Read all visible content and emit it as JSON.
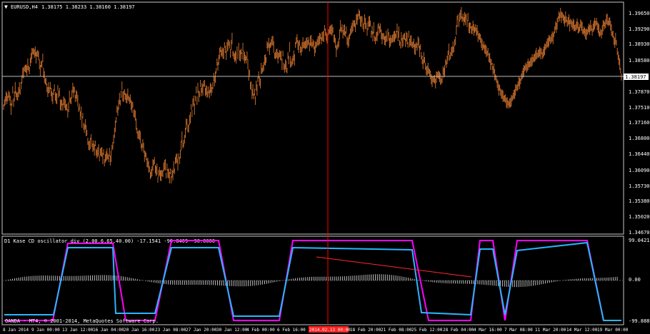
{
  "main_chart": {
    "symbol_timeframe": "EURUSD,H4",
    "ohlc_readout": "1.38175 1.38233 1.38160 1.38197",
    "current_price": "1.38197",
    "price_ticks": [
      "1.39650",
      "1.39290",
      "1.38930",
      "1.38580",
      "1.37870",
      "1.37510",
      "1.37160",
      "1.36800",
      "1.36440",
      "1.36090",
      "1.35730",
      "1.35380",
      "1.35020",
      "1.34670"
    ],
    "series_shape": [
      0.56,
      0.58,
      0.59,
      0.61,
      0.6,
      0.6,
      0.62,
      0.61,
      0.59,
      0.55,
      0.58,
      0.64,
      0.58,
      0.61,
      0.65,
      0.62,
      0.61,
      0.61,
      0.63,
      0.65,
      0.63,
      0.66,
      0.69,
      0.72,
      0.72,
      0.74,
      0.74,
      0.74,
      0.73,
      0.76,
      0.74,
      0.73,
      0.77,
      0.79,
      0.81,
      0.82,
      0.82,
      0.81,
      0.82,
      0.79,
      0.81,
      0.81,
      0.8,
      0.76,
      0.73,
      0.76,
      0.76,
      0.79,
      0.72,
      0.7,
      0.68,
      0.68,
      0.65,
      0.63,
      0.65,
      0.64,
      0.66,
      0.63,
      0.61,
      0.6,
      0.63,
      0.65,
      0.61,
      0.6,
      0.6,
      0.65,
      0.62,
      0.63,
      0.57,
      0.57,
      0.58,
      0.56,
      0.59,
      0.58,
      0.57,
      0.56,
      0.56,
      0.53,
      0.56,
      0.61,
      0.59,
      0.59,
      0.62,
      0.65,
      0.63,
      0.64,
      0.6,
      0.62,
      0.61,
      0.59,
      0.55,
      0.56,
      0.52,
      0.54,
      0.49,
      0.52,
      0.47,
      0.46,
      0.48,
      0.45,
      0.44,
      0.4,
      0.38,
      0.38,
      0.39,
      0.42,
      0.39,
      0.37,
      0.38,
      0.36,
      0.39,
      0.35,
      0.34,
      0.35,
      0.36,
      0.32,
      0.35,
      0.35,
      0.35,
      0.32,
      0.35,
      0.3,
      0.32,
      0.33,
      0.34,
      0.33,
      0.32,
      0.35,
      0.31,
      0.33,
      0.37,
      0.38,
      0.41,
      0.44,
      0.47,
      0.5,
      0.55,
      0.54,
      0.57,
      0.6,
      0.58,
      0.62,
      0.66,
      0.61,
      0.61,
      0.63,
      0.61,
      0.6,
      0.6,
      0.62,
      0.6,
      0.59,
      0.6,
      0.57,
      0.56,
      0.57,
      0.53,
      0.53,
      0.52,
      0.48,
      0.45,
      0.43,
      0.43,
      0.43,
      0.42,
      0.38,
      0.37,
      0.39,
      0.37,
      0.33,
      0.34,
      0.33,
      0.3,
      0.3,
      0.28,
      0.27,
      0.24,
      0.25,
      0.26,
      0.29,
      0.3,
      0.31,
      0.27,
      0.26,
      0.27,
      0.22,
      0.25,
      0.26,
      0.24,
      0.24,
      0.25,
      0.25,
      0.28,
      0.29,
      0.29,
      0.24,
      0.28,
      0.25,
      0.25,
      0.23,
      0.26,
      0.22,
      0.25,
      0.24,
      0.28,
      0.26,
      0.31,
      0.32,
      0.32,
      0.29,
      0.33,
      0.31,
      0.34,
      0.38,
      0.42,
      0.38,
      0.39,
      0.41,
      0.44,
      0.48,
      0.49,
      0.46,
      0.46,
      0.5,
      0.51,
      0.56,
      0.53,
      0.58,
      0.59,
      0.55,
      0.6,
      0.64,
      0.59,
      0.65,
      0.61,
      0.62,
      0.67,
      0.63,
      0.65,
      0.64,
      0.67,
      0.67,
      0.63,
      0.64,
      0.63,
      0.62,
      0.64,
      0.62,
      0.65,
      0.64,
      0.64,
      0.66,
      0.7,
      0.68,
      0.7,
      0.73,
      0.77,
      0.75,
      0.78,
      0.81,
      0.83,
      0.81,
      0.82,
      0.81,
      0.81,
      0.85,
      0.83,
      0.8,
      0.84,
      0.85,
      0.86,
      0.85,
      0.81,
      0.85,
      0.88,
      0.81,
      0.8,
      0.79,
      0.8,
      0.79,
      0.83,
      0.8,
      0.84,
      0.8,
      0.8,
      0.82,
      0.8,
      0.84,
      0.8,
      0.79,
      0.79,
      0.78,
      0.8,
      0.76,
      0.71,
      0.72,
      0.66,
      0.66,
      0.62,
      0.64,
      0.61,
      0.63,
      0.59,
      0.66,
      0.64,
      0.69,
      0.71,
      0.68,
      0.67,
      0.74,
      0.73,
      0.74,
      0.75,
      0.78,
      0.78,
      0.78,
      0.85,
      0.84,
      0.86,
      0.83,
      0.85,
      0.86,
      0.87,
      0.87,
      0.84,
      0.8,
      0.8,
      0.81,
      0.81,
      0.79,
      0.8,
      0.81,
      0.8,
      0.8,
      0.76,
      0.81,
      0.75,
      0.74,
      0.76,
      0.75,
      0.73,
      0.8,
      0.78,
      0.84,
      0.77,
      0.76,
      0.77,
      0.78,
      0.8,
      0.78,
      0.85,
      0.87,
      0.88,
      0.85,
      0.84,
      0.86,
      0.83,
      0.82,
      0.84,
      0.86,
      0.85,
      0.85,
      0.85,
      0.86,
      0.86,
      0.86,
      0.87,
      0.84,
      0.87,
      0.87,
      0.85,
      0.86,
      0.85,
      0.82,
      0.84,
      0.85,
      0.86,
      0.87,
      0.87,
      0.88,
      0.89,
      0.87,
      0.89,
      0.89,
      0.89,
      0.93,
      0.91,
      0.89,
      0.88,
      0.9,
      0.91,
      0.92,
      0.92,
      0.92,
      0.92,
      0.92,
      0.88,
      0.88,
      0.86,
      0.82,
      0.84,
      0.85,
      0.86,
      0.9,
      0.94,
      0.92,
      0.93,
      0.9,
      0.92,
      0.92,
      0.9,
      0.92,
      0.87,
      0.86,
      0.87,
      0.89,
      0.91,
      0.92,
      0.93,
      0.94,
      0.95,
      0.95,
      0.93,
      0.97,
      0.97,
      0.98,
      1.0,
      0.99,
      0.96,
      0.96,
      0.97,
      0.94,
      0.93,
      0.97,
      0.95,
      0.94,
      0.91,
      0.94,
      0.96,
      0.96,
      0.95,
      0.9,
      0.92,
      0.89,
      0.93,
      0.88,
      0.87,
      0.89,
      0.89,
      0.92,
      0.94,
      0.92,
      0.93,
      0.9,
      0.88,
      0.89,
      0.89,
      0.87,
      0.87,
      0.89,
      0.88,
      0.91,
      0.89,
      0.86,
      0.87,
      0.87,
      0.88,
      0.88,
      0.89,
      0.89,
      0.89,
      0.9,
      0.93,
      0.89,
      0.91,
      0.86,
      0.85,
      0.89,
      0.86,
      0.87,
      0.89,
      0.89,
      0.86,
      0.89,
      0.88,
      0.85,
      0.9,
      0.86,
      0.87,
      0.87,
      0.85,
      0.85,
      0.86,
      0.83,
      0.83,
      0.85,
      0.84,
      0.87,
      0.86,
      0.82,
      0.84,
      0.8,
      0.78,
      0.76,
      0.79,
      0.78,
      0.75,
      0.73,
      0.73,
      0.74,
      0.73,
      0.72,
      0.71,
      0.69,
      0.68,
      0.69,
      0.69,
      0.69,
      0.67,
      0.7,
      0.71,
      0.71,
      0.71,
      0.7,
      0.69,
      0.68,
      0.69,
      0.73,
      0.72,
      0.73,
      0.77,
      0.76,
      0.78,
      0.8,
      0.83,
      0.79,
      0.8,
      0.82,
      0.82,
      0.84,
      0.83,
      0.86,
      0.87,
      0.92,
      0.96,
      0.98,
      0.95,
      0.98,
      0.99,
      1.0,
      0.97,
      0.98,
      0.96,
      0.98,
      0.97,
      0.98,
      0.95,
      0.98,
      0.93,
      0.93,
      0.94,
      0.92,
      0.92,
      0.94,
      0.92,
      0.92,
      0.93,
      0.91,
      0.92,
      0.89,
      0.89,
      0.89,
      0.88,
      0.86,
      0.85,
      0.84,
      0.85,
      0.83,
      0.83,
      0.82,
      0.81,
      0.82,
      0.79,
      0.79,
      0.76,
      0.77,
      0.75,
      0.73,
      0.74,
      0.71,
      0.7,
      0.69,
      0.67,
      0.66,
      0.64,
      0.65,
      0.63,
      0.62,
      0.62,
      0.61,
      0.6,
      0.6,
      0.6,
      0.58,
      0.58,
      0.58,
      0.57,
      0.58,
      0.58,
      0.59,
      0.6,
      0.61,
      0.62,
      0.62,
      0.64,
      0.65,
      0.65,
      0.66,
      0.68,
      0.67,
      0.68,
      0.7,
      0.71,
      0.72,
      0.73,
      0.74,
      0.75,
      0.74,
      0.75,
      0.76,
      0.76,
      0.76,
      0.77,
      0.77,
      0.78,
      0.78,
      0.79,
      0.79,
      0.8,
      0.81,
      0.8,
      0.81,
      0.81,
      0.82,
      0.81,
      0.82,
      0.8,
      0.81,
      0.82,
      0.83,
      0.84,
      0.85,
      0.86,
      0.86,
      0.87,
      0.88,
      0.87,
      0.88,
      0.89,
      0.88,
      0.9,
      0.92,
      0.94,
      0.93,
      0.95,
      0.97,
      0.99,
      0.98,
      1.0,
      0.98,
      0.99,
      0.98,
      0.97,
      0.96,
      0.98,
      0.97,
      0.95,
      0.96,
      0.97,
      0.94,
      0.96,
      0.95,
      0.94,
      0.95,
      0.94,
      0.93,
      0.93,
      0.94,
      0.95,
      0.93,
      0.92,
      0.93,
      0.95,
      0.94,
      0.93,
      0.91,
      0.92,
      0.91,
      0.9,
      0.9,
      0.91,
      0.92,
      0.93,
      0.92,
      0.94,
      0.93,
      0.91,
      0.93,
      0.94,
      0.95,
      0.95,
      0.96,
      0.94,
      0.93,
      0.92,
      0.9,
      0.91,
      0.9,
      0.92,
      0.94,
      0.95,
      0.94,
      0.95,
      0.97,
      0.97,
      0.95,
      0.96,
      0.96,
      0.94,
      0.92,
      0.9,
      0.9,
      0.87,
      0.86,
      0.88,
      0.86,
      0.82,
      0.8,
      0.78,
      0.76,
      0.73,
      0.7
    ]
  },
  "indicator": {
    "title": "D1  Kase CD oscillator div (2.00,6.65,40.00) -17.1541 -90.8409 -90.0000",
    "ticks": [
      "99.0421",
      "0.00",
      "-99.8889"
    ],
    "level_zero": "0.00"
  },
  "copyright": "OANDA - MT4, © 2001-2014, MetaQuotes Software Corp.",
  "time_axis": [
    "8 Jan 2014",
    "9 Jan 00:00",
    "13 Jan 12:00",
    "16 Jan 04:00",
    "20 Jan 16:00",
    "23 Jan 08:00",
    "27 Jan 20:00",
    "30 Jan 12:00",
    "4 Feb 00:00",
    "6 Feb 16:00",
    "2014.02.13 00:00",
    "18 Feb 20:00",
    "21 Feb 08:00",
    "25 Feb 12:00",
    "28 Feb 04:00",
    "4 Mar 16:00",
    "7 Mar 08:00",
    "11 Mar 20:00",
    "14 Mar 12:00",
    "19 Mar 00:00"
  ],
  "crosshair_label": "2014.02.13 00:00",
  "colors": {
    "candle": "#c0692a",
    "magenta": "#ff00ff",
    "cyan": "#29b6ff",
    "grid_text": "#ffffff",
    "crosshair": "#ff0000",
    "highlight": "#ff2020",
    "histogram": "#bcbcbc",
    "divergence_red": "#ff2a2a",
    "divergence_green": "#1fae2c"
  }
}
